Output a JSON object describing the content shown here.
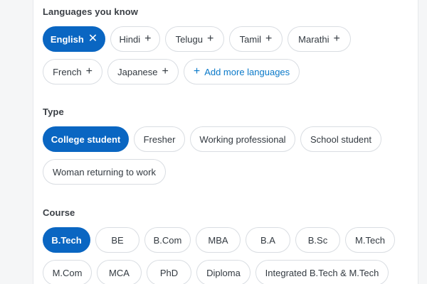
{
  "languages": {
    "title": "Languages you know",
    "items": [
      {
        "label": "English",
        "selected": true
      },
      {
        "label": "Hindi",
        "selected": false
      },
      {
        "label": "Telugu",
        "selected": false
      },
      {
        "label": "Tamil",
        "selected": false
      },
      {
        "label": "Marathi",
        "selected": false
      },
      {
        "label": "French",
        "selected": false
      },
      {
        "label": "Japanese",
        "selected": false
      }
    ],
    "add_more_label": "Add more languages"
  },
  "type": {
    "title": "Type",
    "items": [
      {
        "label": "College student",
        "selected": true
      },
      {
        "label": "Fresher",
        "selected": false
      },
      {
        "label": "Working professional",
        "selected": false
      },
      {
        "label": "School student",
        "selected": false
      },
      {
        "label": "Woman returning to work",
        "selected": false
      }
    ]
  },
  "course": {
    "title": "Course",
    "items": [
      {
        "label": "B.Tech",
        "selected": true
      },
      {
        "label": "BE",
        "selected": false
      },
      {
        "label": "B.Com",
        "selected": false
      },
      {
        "label": "MBA",
        "selected": false
      },
      {
        "label": "B.A",
        "selected": false
      },
      {
        "label": "B.Sc",
        "selected": false
      },
      {
        "label": "M.Tech",
        "selected": false
      },
      {
        "label": "M.Com",
        "selected": false
      },
      {
        "label": "MCA",
        "selected": false
      },
      {
        "label": "PhD",
        "selected": false
      },
      {
        "label": "Diploma",
        "selected": false
      },
      {
        "label": "Integrated B.Tech & M.Tech",
        "selected": false
      }
    ]
  },
  "icons": {
    "remove": "close-icon",
    "add": "plus-icon"
  },
  "colors": {
    "accent": "#0a66c2",
    "link": "#0a79c9",
    "chip_border": "#d9dde2"
  }
}
